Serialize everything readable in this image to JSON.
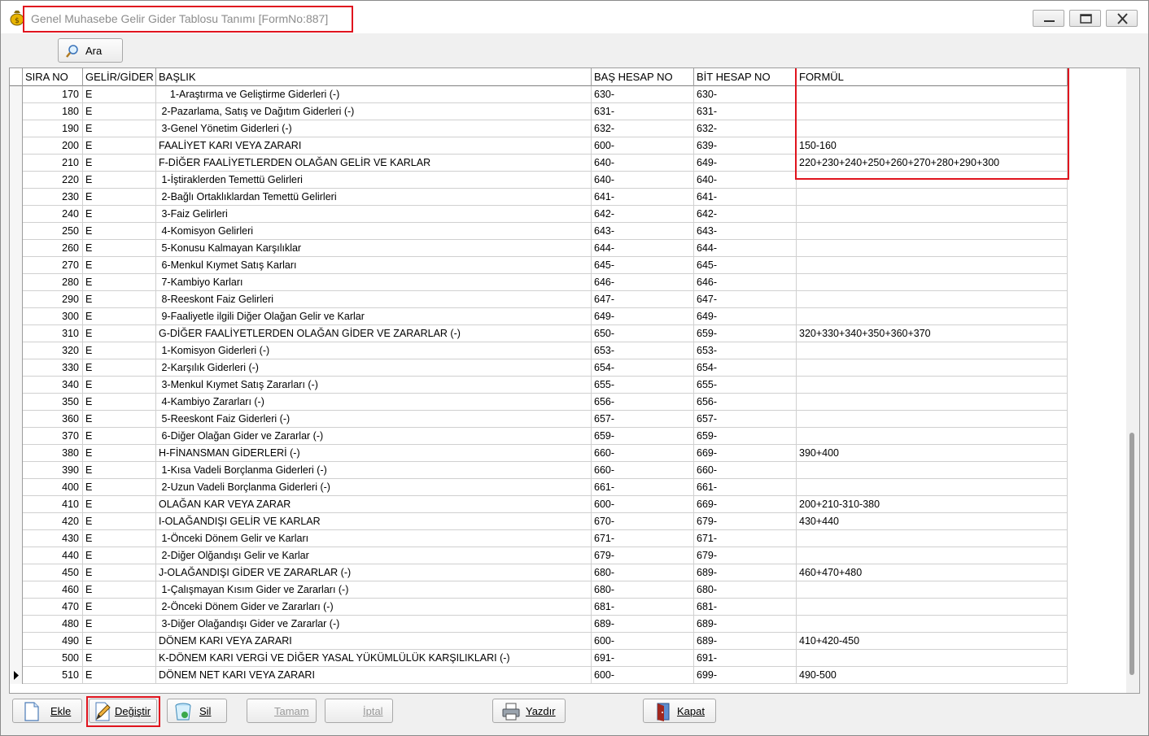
{
  "window": {
    "title": "Genel Muhasebe Gelir Gider Tablosu Tanımı [FormNo:887]"
  },
  "toolbar": {
    "search_label": "Ara"
  },
  "grid": {
    "columns": [
      "SIRA NO",
      "GELİR/GİDER",
      "BAŞLIK",
      "BAŞ HESAP NO",
      "BİT HESAP NO",
      "FORMÜL"
    ],
    "rows": [
      {
        "sira": "170",
        "gg": "E",
        "baslik": "    1-Araştırma ve Geliştirme Giderleri (-)",
        "bas": "630-",
        "bit": "630-",
        "formul": ""
      },
      {
        "sira": "180",
        "gg": "E",
        "baslik": " 2-Pazarlama, Satış ve Dağıtım Giderleri (-)",
        "bas": "631-",
        "bit": "631-",
        "formul": ""
      },
      {
        "sira": "190",
        "gg": "E",
        "baslik": " 3-Genel Yönetim Giderleri (-)",
        "bas": "632-",
        "bit": "632-",
        "formul": ""
      },
      {
        "sira": "200",
        "gg": "E",
        "baslik": "FAALİYET KARI VEYA ZARARI",
        "bas": "600-",
        "bit": "639-",
        "formul": "150-160"
      },
      {
        "sira": "210",
        "gg": "E",
        "baslik": "F-DİĞER FAALİYETLERDEN OLAĞAN GELİR VE KARLAR",
        "bas": "640-",
        "bit": "649-",
        "formul": "220+230+240+250+260+270+280+290+300"
      },
      {
        "sira": "220",
        "gg": "E",
        "baslik": " 1-İştiraklerden Temettü Gelirleri",
        "bas": "640-",
        "bit": "640-",
        "formul": ""
      },
      {
        "sira": "230",
        "gg": "E",
        "baslik": " 2-Bağlı Ortaklıklardan Temettü Gelirleri",
        "bas": "641-",
        "bit": "641-",
        "formul": ""
      },
      {
        "sira": "240",
        "gg": "E",
        "baslik": " 3-Faiz Gelirleri",
        "bas": "642-",
        "bit": "642-",
        "formul": ""
      },
      {
        "sira": "250",
        "gg": "E",
        "baslik": " 4-Komisyon Gelirleri",
        "bas": "643-",
        "bit": "643-",
        "formul": ""
      },
      {
        "sira": "260",
        "gg": "E",
        "baslik": " 5-Konusu Kalmayan Karşılıklar",
        "bas": "644-",
        "bit": "644-",
        "formul": ""
      },
      {
        "sira": "270",
        "gg": "E",
        "baslik": " 6-Menkul Kıymet Satış Karları",
        "bas": "645-",
        "bit": "645-",
        "formul": ""
      },
      {
        "sira": "280",
        "gg": "E",
        "baslik": " 7-Kambiyo Karları",
        "bas": "646-",
        "bit": "646-",
        "formul": ""
      },
      {
        "sira": "290",
        "gg": "E",
        "baslik": " 8-Reeskont Faiz Gelirleri",
        "bas": "647-",
        "bit": "647-",
        "formul": ""
      },
      {
        "sira": "300",
        "gg": "E",
        "baslik": " 9-Faaliyetle ilgili Diğer Olağan Gelir ve Karlar",
        "bas": "649-",
        "bit": "649-",
        "formul": ""
      },
      {
        "sira": "310",
        "gg": "E",
        "baslik": "G-DİĞER FAALİYETLERDEN OLAĞAN GİDER VE ZARARLAR (-)",
        "bas": "650-",
        "bit": "659-",
        "formul": "320+330+340+350+360+370"
      },
      {
        "sira": "320",
        "gg": "E",
        "baslik": " 1-Komisyon Giderleri (-)",
        "bas": "653-",
        "bit": "653-",
        "formul": ""
      },
      {
        "sira": "330",
        "gg": "E",
        "baslik": " 2-Karşılık Giderleri (-)",
        "bas": "654-",
        "bit": "654-",
        "formul": ""
      },
      {
        "sira": "340",
        "gg": "E",
        "baslik": " 3-Menkul Kıymet Satış Zararları (-)",
        "bas": "655-",
        "bit": "655-",
        "formul": ""
      },
      {
        "sira": "350",
        "gg": "E",
        "baslik": " 4-Kambiyo Zararları (-)",
        "bas": "656-",
        "bit": "656-",
        "formul": ""
      },
      {
        "sira": "360",
        "gg": "E",
        "baslik": " 5-Reeskont Faiz Giderleri (-)",
        "bas": "657-",
        "bit": "657-",
        "formul": ""
      },
      {
        "sira": "370",
        "gg": "E",
        "baslik": " 6-Diğer Olağan Gider ve Zararlar (-)",
        "bas": "659-",
        "bit": "659-",
        "formul": ""
      },
      {
        "sira": "380",
        "gg": "E",
        "baslik": "H-FİNANSMAN GİDERLERİ (-)",
        "bas": "660-",
        "bit": "669-",
        "formul": "390+400"
      },
      {
        "sira": "390",
        "gg": "E",
        "baslik": " 1-Kısa Vadeli Borçlanma Giderleri (-)",
        "bas": "660-",
        "bit": "660-",
        "formul": ""
      },
      {
        "sira": "400",
        "gg": "E",
        "baslik": " 2-Uzun Vadeli Borçlanma Giderleri (-)",
        "bas": "661-",
        "bit": "661-",
        "formul": ""
      },
      {
        "sira": "410",
        "gg": "E",
        "baslik": "OLAĞAN KAR VEYA ZARAR",
        "bas": "600-",
        "bit": "669-",
        "formul": "200+210-310-380"
      },
      {
        "sira": "420",
        "gg": "E",
        "baslik": "I-OLAĞANDIŞI GELİR VE KARLAR",
        "bas": "670-",
        "bit": "679-",
        "formul": "430+440"
      },
      {
        "sira": "430",
        "gg": "E",
        "baslik": " 1-Önceki Dönem Gelir ve Karları",
        "bas": "671-",
        "bit": "671-",
        "formul": ""
      },
      {
        "sira": "440",
        "gg": "E",
        "baslik": " 2-Diğer Olğandışı Gelir ve Karlar",
        "bas": "679-",
        "bit": "679-",
        "formul": ""
      },
      {
        "sira": "450",
        "gg": "E",
        "baslik": "J-OLAĞANDIŞI GİDER VE ZARARLAR (-)",
        "bas": "680-",
        "bit": "689-",
        "formul": "460+470+480"
      },
      {
        "sira": "460",
        "gg": "E",
        "baslik": " 1-Çalışmayan Kısım Gider ve Zararları (-)",
        "bas": "680-",
        "bit": "680-",
        "formul": ""
      },
      {
        "sira": "470",
        "gg": "E",
        "baslik": " 2-Önceki Dönem Gider ve Zararları (-)",
        "bas": "681-",
        "bit": "681-",
        "formul": ""
      },
      {
        "sira": "480",
        "gg": "E",
        "baslik": " 3-Diğer Olağandışı Gider ve Zararlar (-)",
        "bas": "689-",
        "bit": "689-",
        "formul": ""
      },
      {
        "sira": "490",
        "gg": "E",
        "baslik": "DÖNEM KARI VEYA ZARARI",
        "bas": "600-",
        "bit": "689-",
        "formul": "410+420-450"
      },
      {
        "sira": "500",
        "gg": "E",
        "baslik": "K-DÖNEM KARI VERGİ VE DİĞER YASAL YÜKÜMLÜLÜK KARŞILIKLARI (-)",
        "bas": "691-",
        "bit": "691-",
        "formul": ""
      },
      {
        "sira": "510",
        "gg": "E",
        "baslik": "DÖNEM NET KARI VEYA ZARARI",
        "bas": "600-",
        "bit": "699-",
        "formul": "490-500"
      }
    ]
  },
  "footer": {
    "add_label": "Ekle",
    "edit_label": "Değiştir",
    "delete_label": "Sil",
    "ok_label": "Tamam",
    "cancel_label": "İptal",
    "print_label": "Yazdır",
    "close_label": "Kapat"
  },
  "colors": {
    "highlight": "#e0141e",
    "title_text": "#8d8d8d"
  },
  "icons": {
    "app": "money-bag-icon",
    "search": "magnifier-icon",
    "add": "new-document-icon",
    "edit": "pencil-icon",
    "delete": "recycle-bin-icon",
    "print": "printer-icon",
    "close": "exit-door-icon"
  }
}
